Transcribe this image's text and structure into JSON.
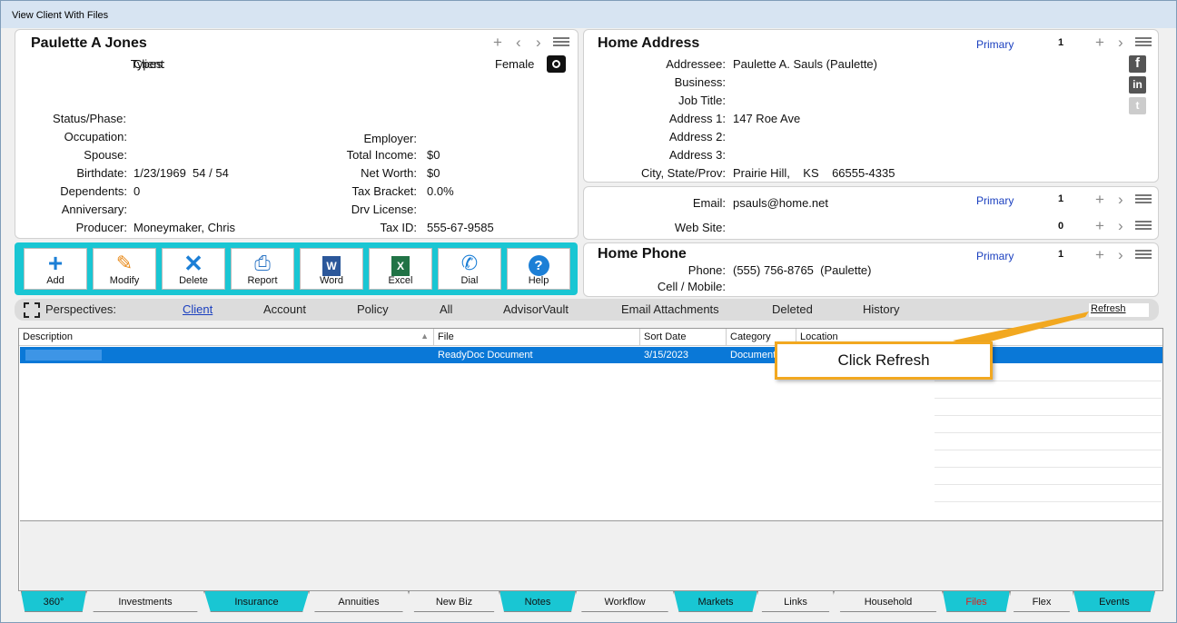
{
  "window": {
    "title": "View Client With Files"
  },
  "client": {
    "name": "Paulette A Jones",
    "gender": "Female",
    "left_fields": [
      {
        "label": "Types:",
        "value": "Client"
      },
      {
        "label": "Status/Phase:",
        "value": ""
      },
      {
        "label": "Occupation:",
        "value": ""
      },
      {
        "label": "Spouse:",
        "value": ""
      },
      {
        "label": "Birthdate:",
        "value": "1/23/1969  54 / 54"
      },
      {
        "label": "Dependents:",
        "value": "0"
      },
      {
        "label": "Anniversary:",
        "value": ""
      },
      {
        "label": "Producer:",
        "value": "Moneymaker, Chris"
      }
    ],
    "right_fields": [
      {
        "label": "Employer:",
        "value": ""
      },
      {
        "label": "Total Income:",
        "value": "$0"
      },
      {
        "label": "Net Worth:",
        "value": "$0"
      },
      {
        "label": "Tax Bracket:",
        "value": "0.0%"
      },
      {
        "label": "Drv License:",
        "value": ""
      },
      {
        "label": "Tax ID:",
        "value": "555-67-9585"
      }
    ]
  },
  "address": {
    "title": "Home Address",
    "primary": "Primary",
    "count": "1",
    "fields": [
      {
        "label": "Addressee:",
        "value": "Paulette A. Sauls (Paulette)"
      },
      {
        "label": "Business:",
        "value": ""
      },
      {
        "label": "Job Title:",
        "value": ""
      },
      {
        "label": "Address 1:",
        "value": "147 Roe Ave"
      },
      {
        "label": "Address 2:",
        "value": ""
      },
      {
        "label": "Address 3:",
        "value": ""
      },
      {
        "label": "City, State/Prov:",
        "value": "Prairie Hill,    KS    66555-4335"
      }
    ]
  },
  "email": {
    "email_label": "Email:",
    "email_value": "psauls@home.net",
    "primary": "Primary",
    "email_count": "1",
    "web_label": "Web Site:",
    "web_value": "",
    "web_count": "0"
  },
  "phone": {
    "title": "Home Phone",
    "primary": "Primary",
    "count": "1",
    "phone_label": "Phone:",
    "phone_value": "(555) 756-8765  (Paulette)",
    "cell_label": "Cell / Mobile:",
    "cell_value": ""
  },
  "toolbar": [
    {
      "label": "Add",
      "icon": "plus-icon"
    },
    {
      "label": "Modify",
      "icon": "pencil-icon"
    },
    {
      "label": "Delete",
      "icon": "x-icon"
    },
    {
      "label": "Report",
      "icon": "printer-icon"
    },
    {
      "label": "Word",
      "icon": "word-icon"
    },
    {
      "label": "Excel",
      "icon": "excel-icon"
    },
    {
      "label": "Dial",
      "icon": "phone-icon"
    },
    {
      "label": "Help",
      "icon": "help-icon"
    }
  ],
  "perspectives": {
    "label": "Perspectives:",
    "tabs": [
      "Client",
      "Account",
      "Policy",
      "All",
      "AdvisorVault",
      "Email Attachments",
      "Deleted",
      "History"
    ],
    "refresh": "Refresh"
  },
  "files_table": {
    "columns": [
      "Description",
      "File",
      "Sort Date",
      "Category",
      "Location"
    ],
    "rows": [
      {
        "description": "",
        "file": "ReadyDoc Document",
        "sort_date": "3/15/2023",
        "category": "Document",
        "location": ""
      }
    ]
  },
  "callout": {
    "text": "Click Refresh",
    "color": "#f2a820"
  },
  "bottom_tabs": [
    "360°",
    "Investments",
    "Insurance",
    "Annuities",
    "New Biz",
    "Notes",
    "Workflow",
    "Markets",
    "Links",
    "Household",
    "Files",
    "Flex",
    "Events"
  ],
  "colors": {
    "accent": "#19c6d3",
    "selection": "#0a78d7",
    "link": "#1a3fbf",
    "files_tab_text": "#e0201c"
  }
}
